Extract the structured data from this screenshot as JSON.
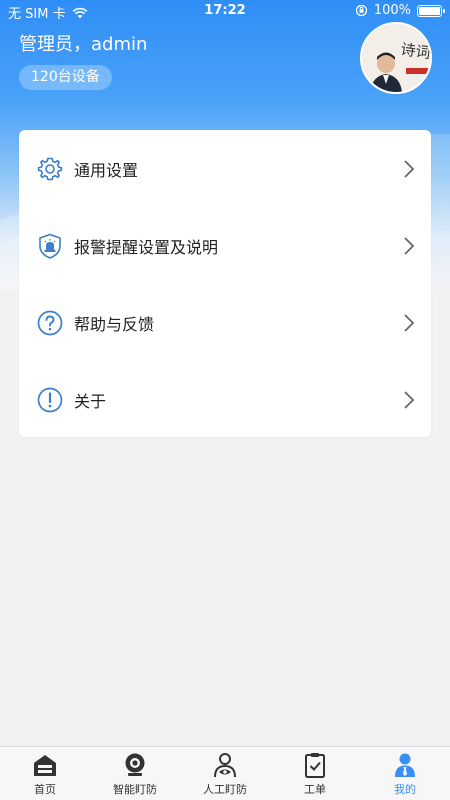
{
  "status_bar": {
    "carrier": "无 SIM 卡",
    "time": "17:22",
    "battery": "100%"
  },
  "profile": {
    "greeting": "管理员，admin",
    "device_count": "120台设备",
    "avatar_text": "诗词"
  },
  "menu": {
    "items": [
      {
        "label": "通用设置",
        "icon": "gear-icon"
      },
      {
        "label": "报警提醒设置及说明",
        "icon": "alarm-shield-icon"
      },
      {
        "label": "帮助与反馈",
        "icon": "help-icon"
      },
      {
        "label": "关于",
        "icon": "info-icon"
      }
    ]
  },
  "tabs": {
    "items": [
      {
        "label": "首页",
        "icon": "home-icon"
      },
      {
        "label": "智能盯防",
        "icon": "camera-icon"
      },
      {
        "label": "人工盯防",
        "icon": "person-watch-icon"
      },
      {
        "label": "工单",
        "icon": "clipboard-icon"
      },
      {
        "label": "我的",
        "icon": "profile-icon",
        "active": true
      }
    ]
  },
  "colors": {
    "accent": "#3a8ef6",
    "icon_blue": "#3d7fc8",
    "background": "#f2f2f4"
  }
}
